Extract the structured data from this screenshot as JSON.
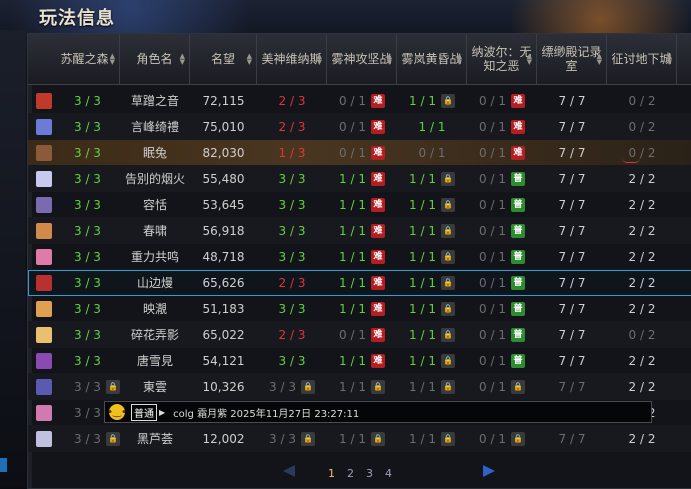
{
  "window": {
    "title": "玩法信息"
  },
  "columns": [
    {
      "label": "苏醒之森",
      "sortable": true
    },
    {
      "label": "角色名",
      "sortable": true
    },
    {
      "label": "名望",
      "sortable": true
    },
    {
      "label": "美神维纳斯",
      "sortable": true
    },
    {
      "label": "雾神攻坚战",
      "sortable": true
    },
    {
      "label": "雾岚黄昏战",
      "sortable": true
    },
    {
      "label": "纳波尔：无知之恶",
      "sortable": true
    },
    {
      "label": "缥缈殿记录室",
      "sortable": true
    },
    {
      "label": "征讨地下城",
      "sortable": true
    },
    {
      "label": "",
      "sortable": false
    }
  ],
  "badges": {
    "hard": "难",
    "normal": "普",
    "lock": "锁"
  },
  "rows": [
    {
      "forest": "3 / 3",
      "name": "草蹭之音",
      "fame": "72,115",
      "venus": "2 / 3",
      "fog": "0 / 1",
      "fogb": "hard",
      "dusk": "1 / 1",
      "duskb": "lock",
      "nabol": "0 / 1",
      "nabolb": "hard",
      "hall": "7 / 7",
      "dungeon": "0 / 2",
      "avatar": "#c0392b"
    },
    {
      "forest": "3 / 3",
      "name": "言峰绮禮",
      "fame": "75,010",
      "venus": "2 / 3",
      "fog": "0 / 1",
      "fogb": "hard",
      "dusk": "1 / 1",
      "duskb": "none",
      "nabol": "0 / 1",
      "nabolb": "hard",
      "hall": "7 / 7",
      "dungeon": "0 / 2",
      "avatar": "#6b7bd6"
    },
    {
      "forest": "3 / 3",
      "name": "眠兔",
      "fame": "82,030",
      "venus": "1 / 3",
      "fog": "0 / 1",
      "fogb": "hard",
      "dusk": "0 / 1",
      "duskb": "none",
      "nabol": "0 / 1",
      "nabolb": "hard",
      "hall": "7 / 7",
      "dungeon": "0 / 2",
      "avatar": "#8a5a3a"
    },
    {
      "forest": "3 / 3",
      "name": "告别的烟火",
      "fame": "55,480",
      "venus": "3 / 3",
      "fog": "1 / 1",
      "fogb": "hard",
      "dusk": "1 / 1",
      "duskb": "lock",
      "nabol": "0 / 1",
      "nabolb": "normal",
      "hall": "7 / 7",
      "dungeon": "2 / 2",
      "avatar": "#c9c9f0"
    },
    {
      "forest": "3 / 3",
      "name": "容恬",
      "fame": "53,645",
      "venus": "3 / 3",
      "fog": "1 / 1",
      "fogb": "hard",
      "dusk": "1 / 1",
      "duskb": "lock",
      "nabol": "0 / 1",
      "nabolb": "normal",
      "hall": "7 / 7",
      "dungeon": "2 / 2",
      "avatar": "#7a6ab0"
    },
    {
      "forest": "3 / 3",
      "name": "春啸",
      "fame": "56,918",
      "venus": "3 / 3",
      "fog": "1 / 1",
      "fogb": "hard",
      "dusk": "1 / 1",
      "duskb": "lock",
      "nabol": "0 / 1",
      "nabolb": "normal",
      "hall": "7 / 7",
      "dungeon": "2 / 2",
      "avatar": "#d28a4a"
    },
    {
      "forest": "3 / 3",
      "name": "重力共鸣",
      "fame": "48,718",
      "venus": "3 / 3",
      "fog": "1 / 1",
      "fogb": "hard",
      "dusk": "1 / 1",
      "duskb": "lock",
      "nabol": "0 / 1",
      "nabolb": "normal",
      "hall": "7 / 7",
      "dungeon": "2 / 2",
      "avatar": "#e07aa8"
    },
    {
      "forest": "3 / 3",
      "name": "山边熳",
      "fame": "65,626",
      "venus": "2 / 3",
      "fog": "1 / 1",
      "fogb": "hard",
      "dusk": "1 / 1",
      "duskb": "lock",
      "nabol": "0 / 1",
      "nabolb": "normal",
      "hall": "7 / 7",
      "dungeon": "2 / 2",
      "avatar": "#b83030"
    },
    {
      "forest": "3 / 3",
      "name": "映㵾",
      "fame": "51,183",
      "venus": "3 / 3",
      "fog": "1 / 1",
      "fogb": "hard",
      "dusk": "1 / 1",
      "duskb": "lock",
      "nabol": "0 / 1",
      "nabolb": "normal",
      "hall": "7 / 7",
      "dungeon": "2 / 2",
      "avatar": "#e0a050"
    },
    {
      "forest": "3 / 3",
      "name": "碎花弄影",
      "fame": "65,022",
      "venus": "2 / 3",
      "fog": "0 / 1",
      "fogb": "hard",
      "dusk": "1 / 1",
      "duskb": "lock",
      "nabol": "0 / 1",
      "nabolb": "normal",
      "hall": "7 / 7",
      "dungeon": "0 / 2",
      "avatar": "#e8c070"
    },
    {
      "forest": "3 / 3",
      "name": "唐雪見",
      "fame": "54,121",
      "venus": "3 / 3",
      "fog": "1 / 1",
      "fogb": "hard",
      "dusk": "1 / 1",
      "duskb": "lock",
      "nabol": "0 / 1",
      "nabolb": "normal",
      "hall": "7 / 7",
      "dungeon": "2 / 2",
      "avatar": "#8a4ab0"
    },
    {
      "forest": "3 / 3",
      "name": "東雲",
      "fame": "10,326",
      "venus": "3 / 3",
      "fog": "1 / 1",
      "fogb": "lock",
      "dusk": "1 / 1",
      "duskb": "lock",
      "nabol": "0 / 1",
      "nabolb": "lock",
      "hall": "7 / 7",
      "dungeon": "2 / 2",
      "avatar": "#5a5ab0",
      "locked": true
    },
    {
      "forest": "3 / 3",
      "name": "",
      "fame": "",
      "venus": "",
      "fog": "1 / 1",
      "fogb": "lock",
      "dusk": "1 / 1",
      "duskb": "lock",
      "nabol": "0 / 1",
      "nabolb": "lock",
      "hall": "7 / 7",
      "dungeon": "2 / 2",
      "avatar": "#d07ab0",
      "locked": true
    },
    {
      "forest": "3 / 3",
      "name": "黑芦荟",
      "fame": "12,002",
      "venus": "3 / 3",
      "fog": "1 / 1",
      "fogb": "lock",
      "dusk": "1 / 1",
      "duskb": "lock",
      "nabol": "0 / 1",
      "nabolb": "lock",
      "hall": "7 / 7",
      "dungeon": "2 / 2",
      "avatar": "#c0c0e0",
      "locked": true
    }
  ],
  "pagination": {
    "pages": [
      "1",
      "2",
      "3",
      "4"
    ],
    "current": "1"
  },
  "chat": {
    "channel": "普通",
    "text": "colg    霜月紫    2025年11月27日 23:27:11"
  },
  "colors": {
    "green": "#5fd33c",
    "red": "#e0343a",
    "selected_outline": "#2aa0d8"
  }
}
